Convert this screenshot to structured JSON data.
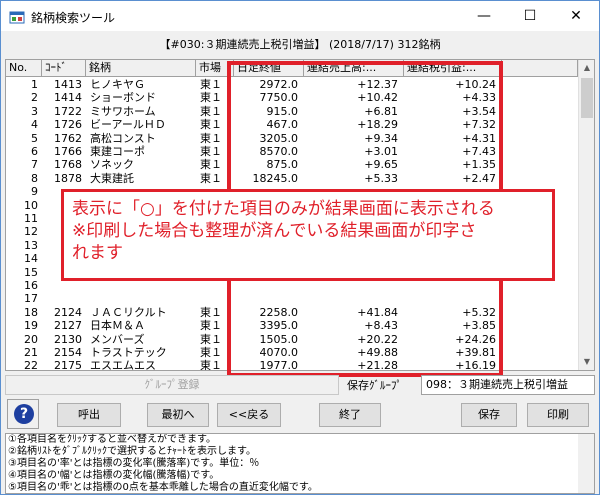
{
  "window": {
    "title": "銘柄検索ツール",
    "min_icon": "—",
    "max_icon": "☐",
    "close_icon": "✕"
  },
  "header": {
    "text": "【#030:３期連続売上税引増益】 (2018/7/17) 312銘柄"
  },
  "table": {
    "columns": [
      "No.",
      "ｺｰﾄﾞ",
      "銘柄",
      "市場",
      "日足終値",
      "連結売上高:...",
      "連結税引益:..."
    ],
    "rows": [
      [
        "1",
        "1413",
        "ヒノキヤＧ",
        "東１",
        "2972.0",
        "+12.37",
        "+10.24"
      ],
      [
        "2",
        "1414",
        "ショーボンド",
        "東１",
        "7750.0",
        "+10.42",
        "+4.33"
      ],
      [
        "3",
        "1722",
        "ミサワホーム",
        "東１",
        "915.0",
        "+6.81",
        "+3.54"
      ],
      [
        "4",
        "1726",
        "ビーアールＨＤ",
        "東１",
        "467.0",
        "+18.29",
        "+7.32"
      ],
      [
        "5",
        "1762",
        "高松コンスト",
        "東１",
        "3205.0",
        "+9.34",
        "+4.31"
      ],
      [
        "6",
        "1766",
        "東建コーポ",
        "東１",
        "8570.0",
        "+3.01",
        "+7.43"
      ],
      [
        "7",
        "1768",
        "ソネック",
        "東１",
        "875.0",
        "+9.65",
        "+1.35"
      ],
      [
        "8",
        "1878",
        "大東建託",
        "東１",
        "18245.0",
        "+5.33",
        "+2.47"
      ],
      [
        "9",
        "",
        "",
        "",
        "",
        "",
        ""
      ],
      [
        "10",
        "",
        "",
        "",
        "",
        "",
        ""
      ],
      [
        "11",
        "",
        "",
        "",
        "",
        "",
        ""
      ],
      [
        "12",
        "",
        "",
        "",
        "",
        "",
        ""
      ],
      [
        "13",
        "",
        "",
        "",
        "",
        "",
        ""
      ],
      [
        "14",
        "",
        "",
        "",
        "",
        "",
        ""
      ],
      [
        "15",
        "",
        "",
        "",
        "",
        "",
        ""
      ],
      [
        "16",
        "",
        "",
        "",
        "",
        "",
        ""
      ],
      [
        "17",
        "",
        "",
        "",
        "",
        "",
        ""
      ],
      [
        "18",
        "2124",
        "ＪＡＣリクルト",
        "東１",
        "2258.0",
        "+41.84",
        "+5.32"
      ],
      [
        "19",
        "2127",
        "日本Ｍ＆Ａ",
        "東１",
        "3395.0",
        "+8.43",
        "+3.85"
      ],
      [
        "20",
        "2130",
        "メンバーズ",
        "東１",
        "1505.0",
        "+20.22",
        "+24.26"
      ],
      [
        "21",
        "2154",
        "トラストテック",
        "東１",
        "4070.0",
        "+49.88",
        "+39.81"
      ],
      [
        "22",
        "2175",
        "エスエムエス",
        "東１",
        "1977.0",
        "+21.28",
        "+16.19"
      ]
    ]
  },
  "callout": {
    "line1": "表示に「○」を付けた項目のみが結果画面に表示される",
    "line2": "※印刷した場合も整理が済んでいる結果画面が印字さ",
    "line3": "れます"
  },
  "group": {
    "register_label": "ｸﾞﾙｰﾌﾟ登録",
    "save_group_label": "保存ｸﾞﾙｰﾌﾟ",
    "save_group_value": "098：３期連続売上税引増益"
  },
  "buttons": {
    "call": "呼出",
    "first": "最初へ",
    "back": "<<戻る",
    "end": "終了",
    "save": "保存",
    "print": "印刷"
  },
  "help": [
    "①各項目名をｸﾘｯｸすると並べ替えができます。",
    "②銘柄ﾘｽﾄをﾀﾞﾌﾞﾙｸﾘｯｸで選択するとﾁｬｰﾄを表示します。",
    "③項目名の'率'とは指標の変化率(騰落率)です。単位：％",
    "④項目名の'幅'とは指標の変化幅(騰落幅)です。",
    "⑤項目名の'乖'とは指標の0点を基本乖離した場合の直近変化幅です。"
  ],
  "colors": {
    "highlight": "#e0202a",
    "help_icon": "#1e3fa0"
  }
}
